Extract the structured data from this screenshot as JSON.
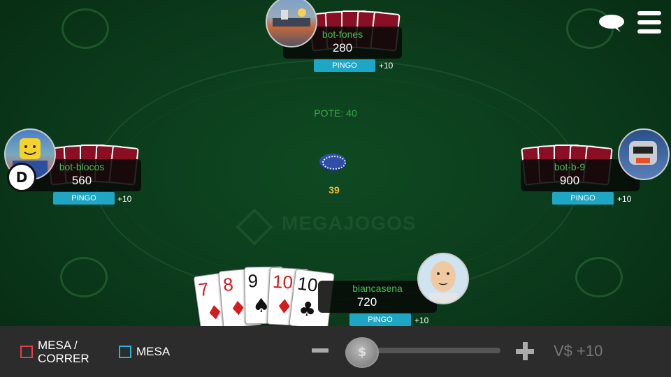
{
  "pot": {
    "label": "POTE: 40",
    "bet": "39"
  },
  "logo": {
    "text": "MEGAJOGOS"
  },
  "players": {
    "top": {
      "name": "bot-fones",
      "chips": "280",
      "pingo": "PINGO",
      "plus": "+10"
    },
    "left": {
      "name": "bot-blocos",
      "chips": "560",
      "pingo": "PINGO",
      "plus": "+10",
      "dealer": "D"
    },
    "right": {
      "name": "bot-b-9",
      "chips": "900",
      "pingo": "PINGO",
      "plus": "+10"
    },
    "me": {
      "name": "biancasena",
      "chips": "720",
      "pingo": "PINGO",
      "plus": "+10"
    }
  },
  "hand": [
    {
      "rank": "7",
      "suit": "♦",
      "color": "red"
    },
    {
      "rank": "8",
      "suit": "♦",
      "color": "red"
    },
    {
      "rank": "9",
      "suit": "♠",
      "color": "black"
    },
    {
      "rank": "10",
      "suit": "♦",
      "color": "red"
    },
    {
      "rank": "10",
      "suit": "♣",
      "color": "black"
    }
  ],
  "bottom": {
    "mesa_correr": "MESA /\nCORRER",
    "mesa": "MESA",
    "slider_symbol": "$",
    "bet_value": "V$ +10",
    "mesa_correr_color": "#e0424a",
    "mesa_color": "#27b6d8"
  }
}
